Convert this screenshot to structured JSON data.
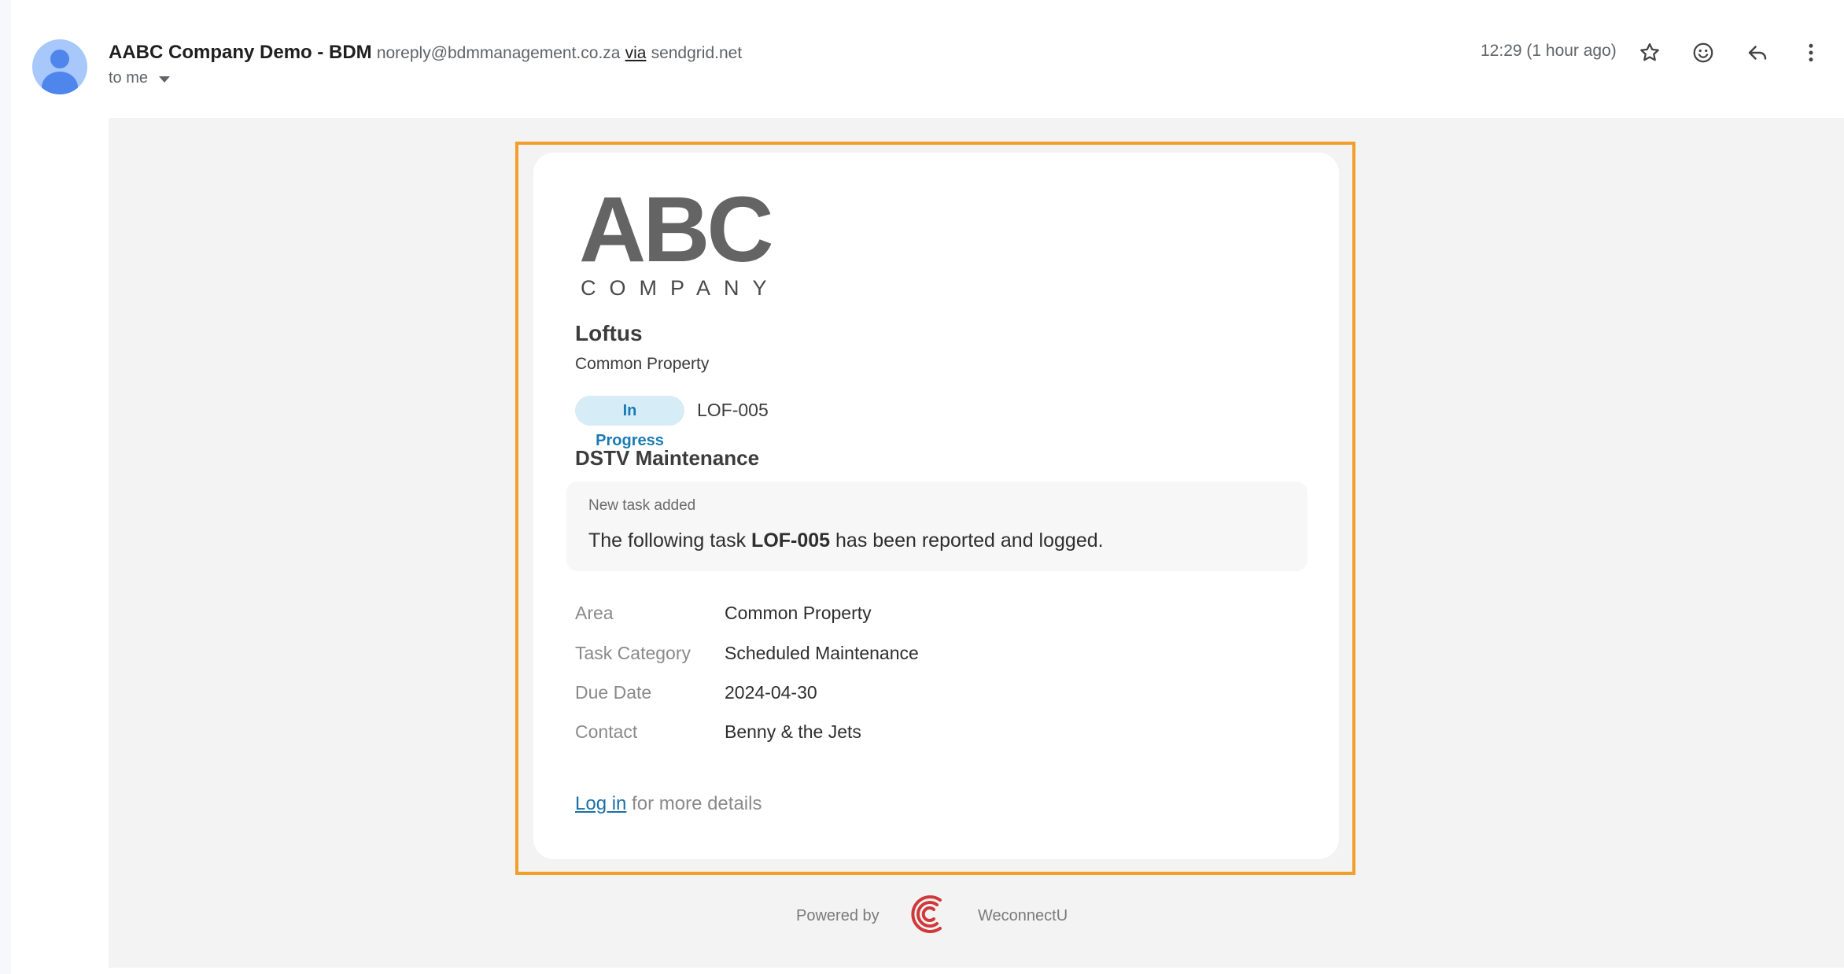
{
  "header": {
    "sender_name": "AABC Company Demo - BDM",
    "sender_email": "noreply@bdmmanagement.co.za",
    "via_label": "via",
    "via_domain": "sendgrid.net",
    "recipient_label": "to me",
    "timestamp": "12:29 (1 hour ago)",
    "icons": [
      "star-icon",
      "emoji-icon",
      "reply-icon",
      "more-vert-icon"
    ]
  },
  "email": {
    "logo": {
      "main": "ABC",
      "sub": "COMPANY"
    },
    "property_name": "Loftus",
    "property_area": "Common Property",
    "status_badge": "In Progress",
    "status_color": "#d6ecf7",
    "task_code": "LOF-005",
    "task_title": "DSTV Maintenance",
    "notice": {
      "heading": "New task added",
      "message_pre": "The following task ",
      "message_code": "LOF-005",
      "message_post": " has been reported and logged."
    },
    "details": [
      {
        "label": "Area",
        "value": "Common Property"
      },
      {
        "label": "Task Category",
        "value": "Scheduled Maintenance"
      },
      {
        "label": "Due Date",
        "value": "2024-04-30"
      },
      {
        "label": "Contact",
        "value": "Benny & the Jets"
      }
    ],
    "login_link": "Log in",
    "login_suffix": " for more details",
    "highlight_color": "#f0a02a"
  },
  "footer": {
    "powered_by": "Powered by",
    "brand": "WeconnectU"
  }
}
